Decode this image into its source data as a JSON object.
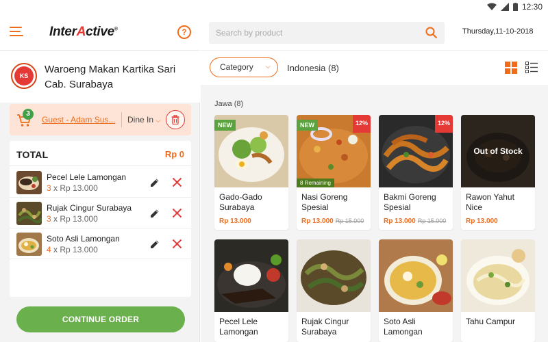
{
  "status_bar": {
    "time": "12:30"
  },
  "header": {
    "logo_text_a": "Inter",
    "logo_text_b": "A",
    "logo_text_c": "ctive",
    "help_label": "?"
  },
  "store": {
    "logo_text": "KS",
    "name": "Waroeng Makan Kartika Sari Cab. Surabaya"
  },
  "order_bar": {
    "cart_count": "3",
    "guest": "Guest - Adam Sus...",
    "dine_mode": "Dine In"
  },
  "order": {
    "total_label": "TOTAL",
    "total_value": "Rp 0",
    "items": [
      {
        "name": "Pecel Lele Lamongan",
        "qty": "3",
        "unit": "x Rp 13.000"
      },
      {
        "name": "Rujak Cingur Surabaya",
        "qty": "3",
        "unit": "x Rp 13.000"
      },
      {
        "name": "Soto Asli Lamongan",
        "qty": "4",
        "unit": "x Rp 13.000"
      }
    ]
  },
  "continue_label": "CONTINUE ORDER",
  "search": {
    "placeholder": "Search by product"
  },
  "date": "Thursday,11-10-2018",
  "filter": {
    "category_label": "Category",
    "current": "Indonesia (8)"
  },
  "section": {
    "label": "Jawa (8)"
  },
  "products": [
    {
      "name": "Gado-Gado Surabaya",
      "price": "Rp 13.000",
      "old_price": "",
      "badge_new": "NEW",
      "discount": "",
      "remaining": "",
      "out_of_stock": ""
    },
    {
      "name": "Nasi Goreng Spesial",
      "price": "Rp 13.000",
      "old_price": "Rp 15.000",
      "badge_new": "NEW",
      "discount": "12%",
      "remaining": "8 Remaining",
      "out_of_stock": ""
    },
    {
      "name": "Bakmi Goreng Spesial",
      "price": "Rp 13.000",
      "old_price": "Rp 15.000",
      "badge_new": "",
      "discount": "12%",
      "remaining": "",
      "out_of_stock": ""
    },
    {
      "name": "Rawon Yahut Nice",
      "price": "Rp 13.000",
      "old_price": "",
      "badge_new": "",
      "discount": "",
      "remaining": "",
      "out_of_stock": "Out of Stock"
    },
    {
      "name": "Pecel Lele Lamongan",
      "price": "",
      "old_price": "",
      "badge_new": "",
      "discount": "",
      "remaining": "",
      "out_of_stock": ""
    },
    {
      "name": "Rujak Cingur Surabaya",
      "price": "",
      "old_price": "",
      "badge_new": "",
      "discount": "",
      "remaining": "",
      "out_of_stock": ""
    },
    {
      "name": "Soto Asli Lamongan",
      "price": "",
      "old_price": "",
      "badge_new": "",
      "discount": "",
      "remaining": "",
      "out_of_stock": ""
    },
    {
      "name": "Tahu Campur",
      "price": "",
      "old_price": "",
      "badge_new": "",
      "discount": "",
      "remaining": "",
      "out_of_stock": ""
    }
  ],
  "colors": {
    "accent": "#ef6c1a",
    "green": "#6ab04c",
    "red": "#e53935"
  }
}
